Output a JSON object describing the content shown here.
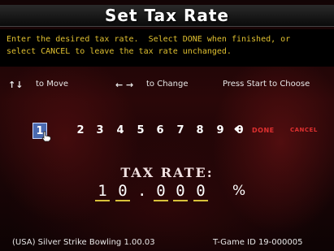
{
  "title": "Set Tax Rate",
  "instructions": {
    "line1": "Enter the desired tax rate.  Select DONE when finished, or",
    "line2": "select CANCEL to leave the tax rate unchanged."
  },
  "nav": {
    "updown_arrows": "↑↓",
    "move_label": "to Move",
    "leftright_arrows": "← →",
    "change_label": "to Change",
    "press_start": "Press Start to Choose"
  },
  "keypad": {
    "digits": [
      "1",
      "2",
      "3",
      "4",
      "5",
      "6",
      "7",
      "8",
      "9",
      "0"
    ],
    "selected": "1",
    "back_arrow": "←",
    "done": "DONE",
    "cancel": "CANCEL"
  },
  "tax_rate": {
    "label": "TAX RATE:",
    "digits": [
      "1",
      "0",
      "0",
      "0",
      "0"
    ],
    "decimal": ".",
    "percent": "%"
  },
  "footer": {
    "left": "(USA) Silver Strike Bowling 1.00.03",
    "right": "T-Game ID 19-000005"
  },
  "colors": {
    "instruction_text": "#e0c030",
    "done_cancel": "#e03030",
    "selection": "#4a6ab0",
    "underline": "#d8c23a"
  },
  "icons": [
    "hand-pointer-icon",
    "up-down-arrows-icon",
    "left-right-arrows-icon",
    "back-arrow-icon"
  ]
}
